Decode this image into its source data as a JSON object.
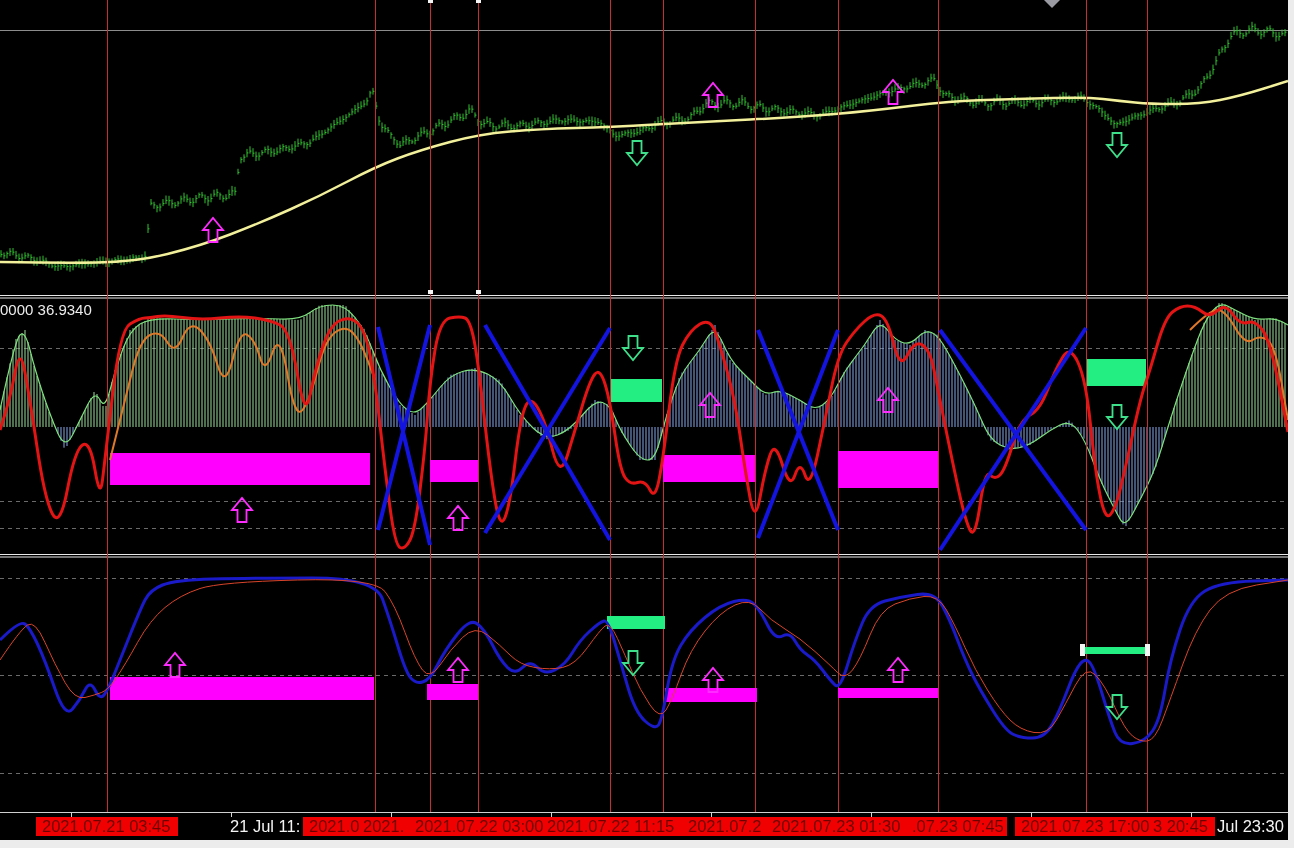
{
  "indicator_panel": {
    "readout": "0000 36.9340"
  },
  "time_axis": {
    "labels": [
      {
        "text": "2021.07.21 03:45",
        "kind": "highlight"
      },
      {
        "text": "21 Jul 11:",
        "kind": "plain"
      },
      {
        "text": "2021.0",
        "kind": "highlight"
      },
      {
        "text": "2021.",
        "kind": "highlight"
      },
      {
        "text": "2021.07.22 03:00",
        "kind": "highlight"
      },
      {
        "text": "2021.07.22 11:15",
        "kind": "highlight"
      },
      {
        "text": "2021.07.2",
        "kind": "highlight"
      },
      {
        "text": "2021.07.23 01:30",
        "kind": "highlight"
      },
      {
        "text": ".07.23 07:45",
        "kind": "highlight"
      },
      {
        "text": "2021.07.23 17:00",
        "kind": "highlight"
      },
      {
        "text": "3 20:45",
        "kind": "highlight"
      },
      {
        "text": "Jul 23:30",
        "kind": "plain"
      }
    ]
  }
}
